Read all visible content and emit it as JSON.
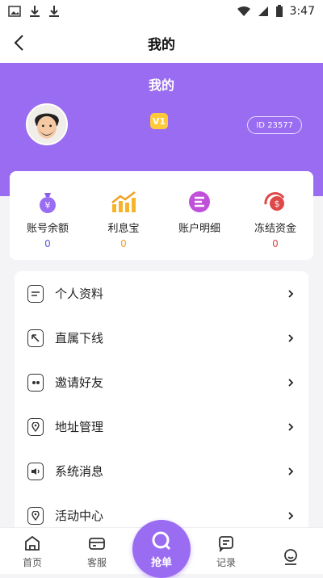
{
  "status": {
    "time": "3:47"
  },
  "nav": {
    "title": "我的"
  },
  "profile": {
    "title": "我的",
    "vip": "V1",
    "id_text": "ID 23577"
  },
  "stats": [
    {
      "label": "账号余额",
      "value": "0",
      "value_color": "#5b5bd6",
      "icon": "money-bag-icon"
    },
    {
      "label": "利息宝",
      "value": "0",
      "value_color": "#f0a020",
      "icon": "chart-up-icon"
    },
    {
      "label": "账户明细",
      "value": "",
      "value_color": "#c04fd9",
      "icon": "account-detail-icon"
    },
    {
      "label": "冻结资金",
      "value": "0",
      "value_color": "#e04848",
      "icon": "frozen-funds-icon"
    }
  ],
  "menu": [
    {
      "label": "个人资料",
      "icon": "profile-doc-icon"
    },
    {
      "label": "直属下线",
      "icon": "team-icon"
    },
    {
      "label": "邀请好友",
      "icon": "invite-icon"
    },
    {
      "label": "地址管理",
      "icon": "location-icon"
    },
    {
      "label": "系统消息",
      "icon": "speaker-icon"
    },
    {
      "label": "活动中心",
      "icon": "activity-icon"
    }
  ],
  "tabs": [
    {
      "label": "首页",
      "icon": "home-icon"
    },
    {
      "label": "客服",
      "icon": "support-icon"
    },
    {
      "label": "抢单",
      "icon": "grab-order-icon"
    },
    {
      "label": "记录",
      "icon": "records-icon"
    },
    {
      "label": "",
      "icon": "profile-icon"
    }
  ],
  "colors": {
    "accent": "#9a6cf2"
  }
}
